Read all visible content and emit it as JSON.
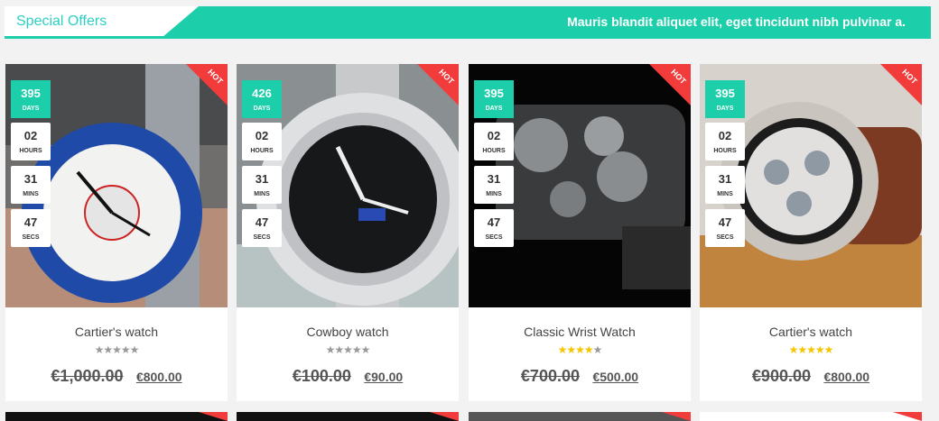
{
  "banner": {
    "title": "Special Offers",
    "text": "Mauris blandit aliquet elit, eget tincidunt nibh pulvinar a."
  },
  "colors": {
    "accent": "#1ccfaa",
    "hot": "#f23b3b",
    "star_on": "#f5c600",
    "star_off": "#9a9a9a"
  },
  "countdown_labels": {
    "days": "DAYS",
    "hours": "HOURS",
    "mins": "MINS",
    "secs": "SECS"
  },
  "hot_label": "HOT",
  "products": [
    {
      "title": "Cartier's watch",
      "days": "395",
      "hours": "02",
      "mins": "31",
      "secs": "47",
      "rating": 0,
      "old_price": "€1,000.00",
      "new_price": "€800.00"
    },
    {
      "title": "Cowboy watch",
      "days": "426",
      "hours": "02",
      "mins": "31",
      "secs": "47",
      "rating": 0,
      "old_price": "€100.00",
      "new_price": "€90.00"
    },
    {
      "title": "Classic Wrist Watch",
      "days": "395",
      "hours": "02",
      "mins": "31",
      "secs": "47",
      "rating": 4,
      "old_price": "€700.00",
      "new_price": "€500.00"
    },
    {
      "title": "Cartier's watch",
      "days": "395",
      "hours": "02",
      "mins": "31",
      "secs": "47",
      "rating": 5,
      "old_price": "€900.00",
      "new_price": "€800.00"
    }
  ]
}
